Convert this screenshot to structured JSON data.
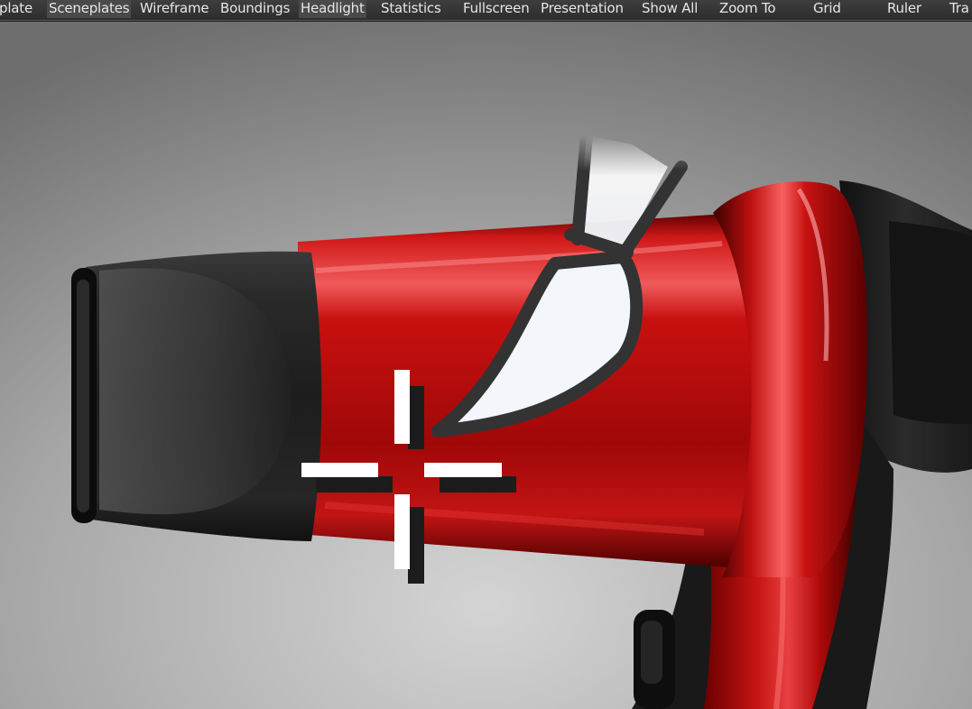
{
  "toolbar": {
    "items": [
      {
        "label": "plate"
      },
      {
        "label": "Sceneplates"
      },
      {
        "label": "Wireframe"
      },
      {
        "label": "Boundings"
      },
      {
        "label": "Headlight"
      },
      {
        "label": "Statistics"
      },
      {
        "label": "Fullscreen"
      },
      {
        "label": "Presentation"
      },
      {
        "label": "Show All"
      },
      {
        "label": "Zoom To"
      },
      {
        "label": "Grid"
      },
      {
        "label": "Ruler"
      },
      {
        "label": "Tra"
      }
    ]
  },
  "viewport": {
    "scene": "hair-dryer-render",
    "cursor_icon": "paintbrush-crosshair-icon",
    "colors": {
      "body_red": "#b30a0a",
      "nozzle_black": "#1c1c1c",
      "background": "#9c9c9c"
    }
  }
}
